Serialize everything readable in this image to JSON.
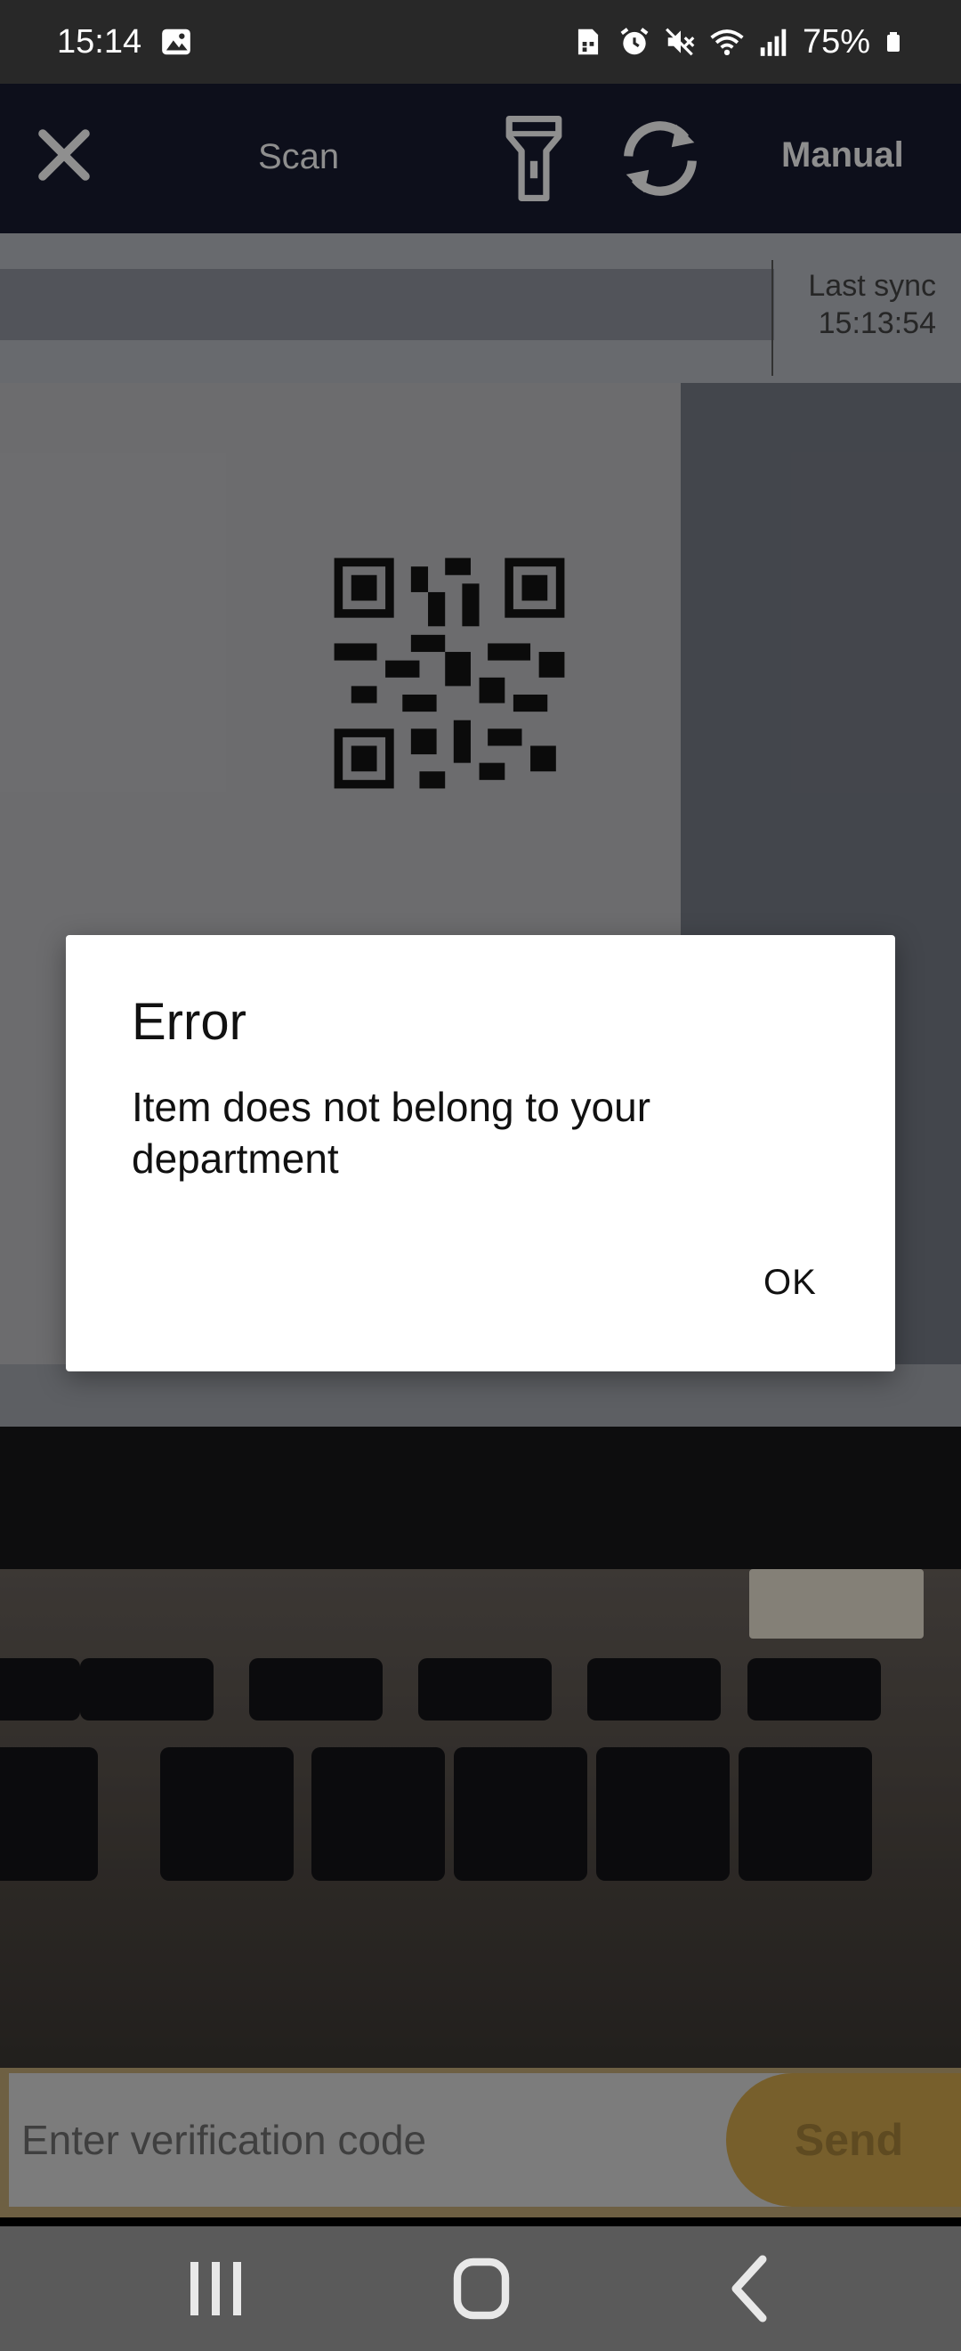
{
  "status_bar": {
    "time": "15:14",
    "battery": "75%",
    "icons": [
      "gallery-icon",
      "sim-icon",
      "alarm-icon",
      "mute-icon",
      "wifi-icon",
      "signal-icon",
      "battery-icon"
    ]
  },
  "toolbar": {
    "title": "Scan",
    "manual_label": "Manual",
    "icons": [
      "close-icon",
      "flashlight-icon",
      "switch-camera-icon"
    ]
  },
  "sync": {
    "label": "Last sync",
    "time": "15:13:54"
  },
  "dialog": {
    "title": "Error",
    "message": "Item does not belong to your department",
    "ok_label": "OK"
  },
  "input": {
    "placeholder": "Enter verification code",
    "value": "",
    "send_label": "Send"
  },
  "nav_bar": {
    "icons": [
      "recents-icon",
      "home-icon",
      "back-icon"
    ]
  },
  "colors": {
    "toolbar_bg": "#0d0f1b",
    "status_bg": "#282828",
    "send_accent": "#775f2c",
    "dialog_bg": "#ffffff"
  }
}
